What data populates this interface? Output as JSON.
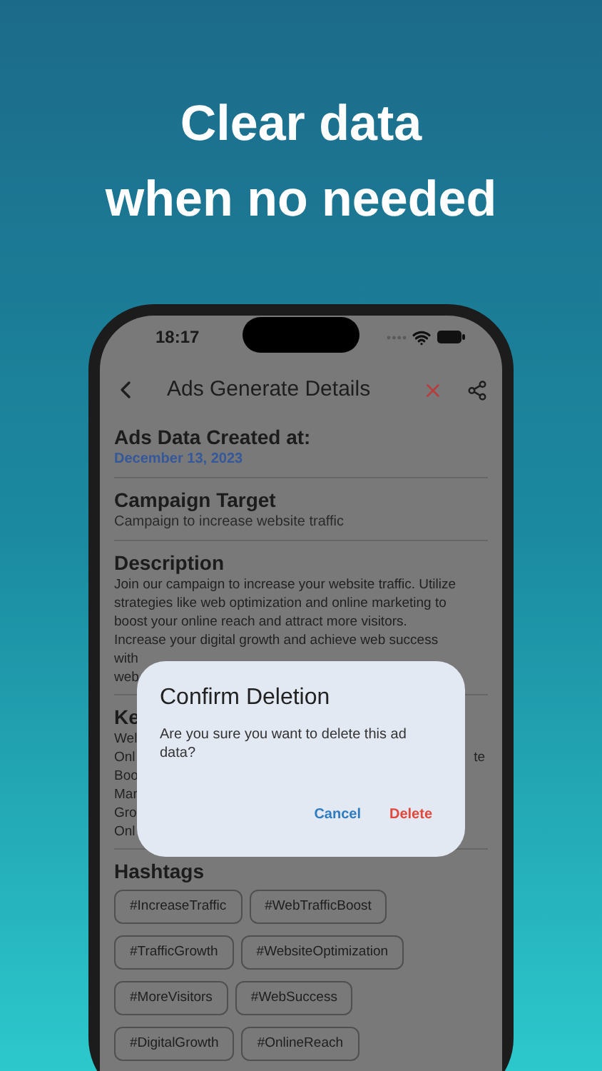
{
  "headline": [
    "Clear data",
    "when no needed"
  ],
  "status_bar": {
    "time": "18:17"
  },
  "header": {
    "title": "Ads Generate Details"
  },
  "created": {
    "heading": "Ads Data Created at:",
    "date": "December 13, 2023"
  },
  "campaign": {
    "heading": "Campaign Target",
    "text": "Campaign to increase website traffic"
  },
  "description": {
    "heading": "Description",
    "lines": [
      "Join our campaign to increase your website traffic. Utilize",
      "strategies like web optimization and online marketing to",
      "boost your online reach and attract more visitors.",
      "Increase your digital growth and achieve web success",
      "with",
      "web"
    ]
  },
  "keywords": {
    "heading": "Ke",
    "lines": [
      {
        "text": "Wel"
      },
      {
        "text": "Onl",
        "tail": "te"
      },
      {
        "text": "Boo"
      },
      {
        "text": "Mar"
      },
      {
        "text": "Gro"
      },
      {
        "text": "Onl"
      }
    ]
  },
  "hashtags": {
    "heading": "Hashtags",
    "rows": [
      [
        "#IncreaseTraffic",
        "#WebTrafficBoost"
      ],
      [
        "#TrafficGrowth",
        "#WebsiteOptimization"
      ],
      [
        "#MoreVisitors",
        "#WebSuccess"
      ],
      [
        "#DigitalGrowth",
        "#OnlineReach"
      ]
    ]
  },
  "dialog": {
    "title": "Confirm Deletion",
    "message": "Are you sure you want to delete this ad data?",
    "buttons": [
      {
        "label": "Cancel",
        "kind": "cancel"
      },
      {
        "label": "Delete",
        "kind": "destructive"
      }
    ]
  }
}
